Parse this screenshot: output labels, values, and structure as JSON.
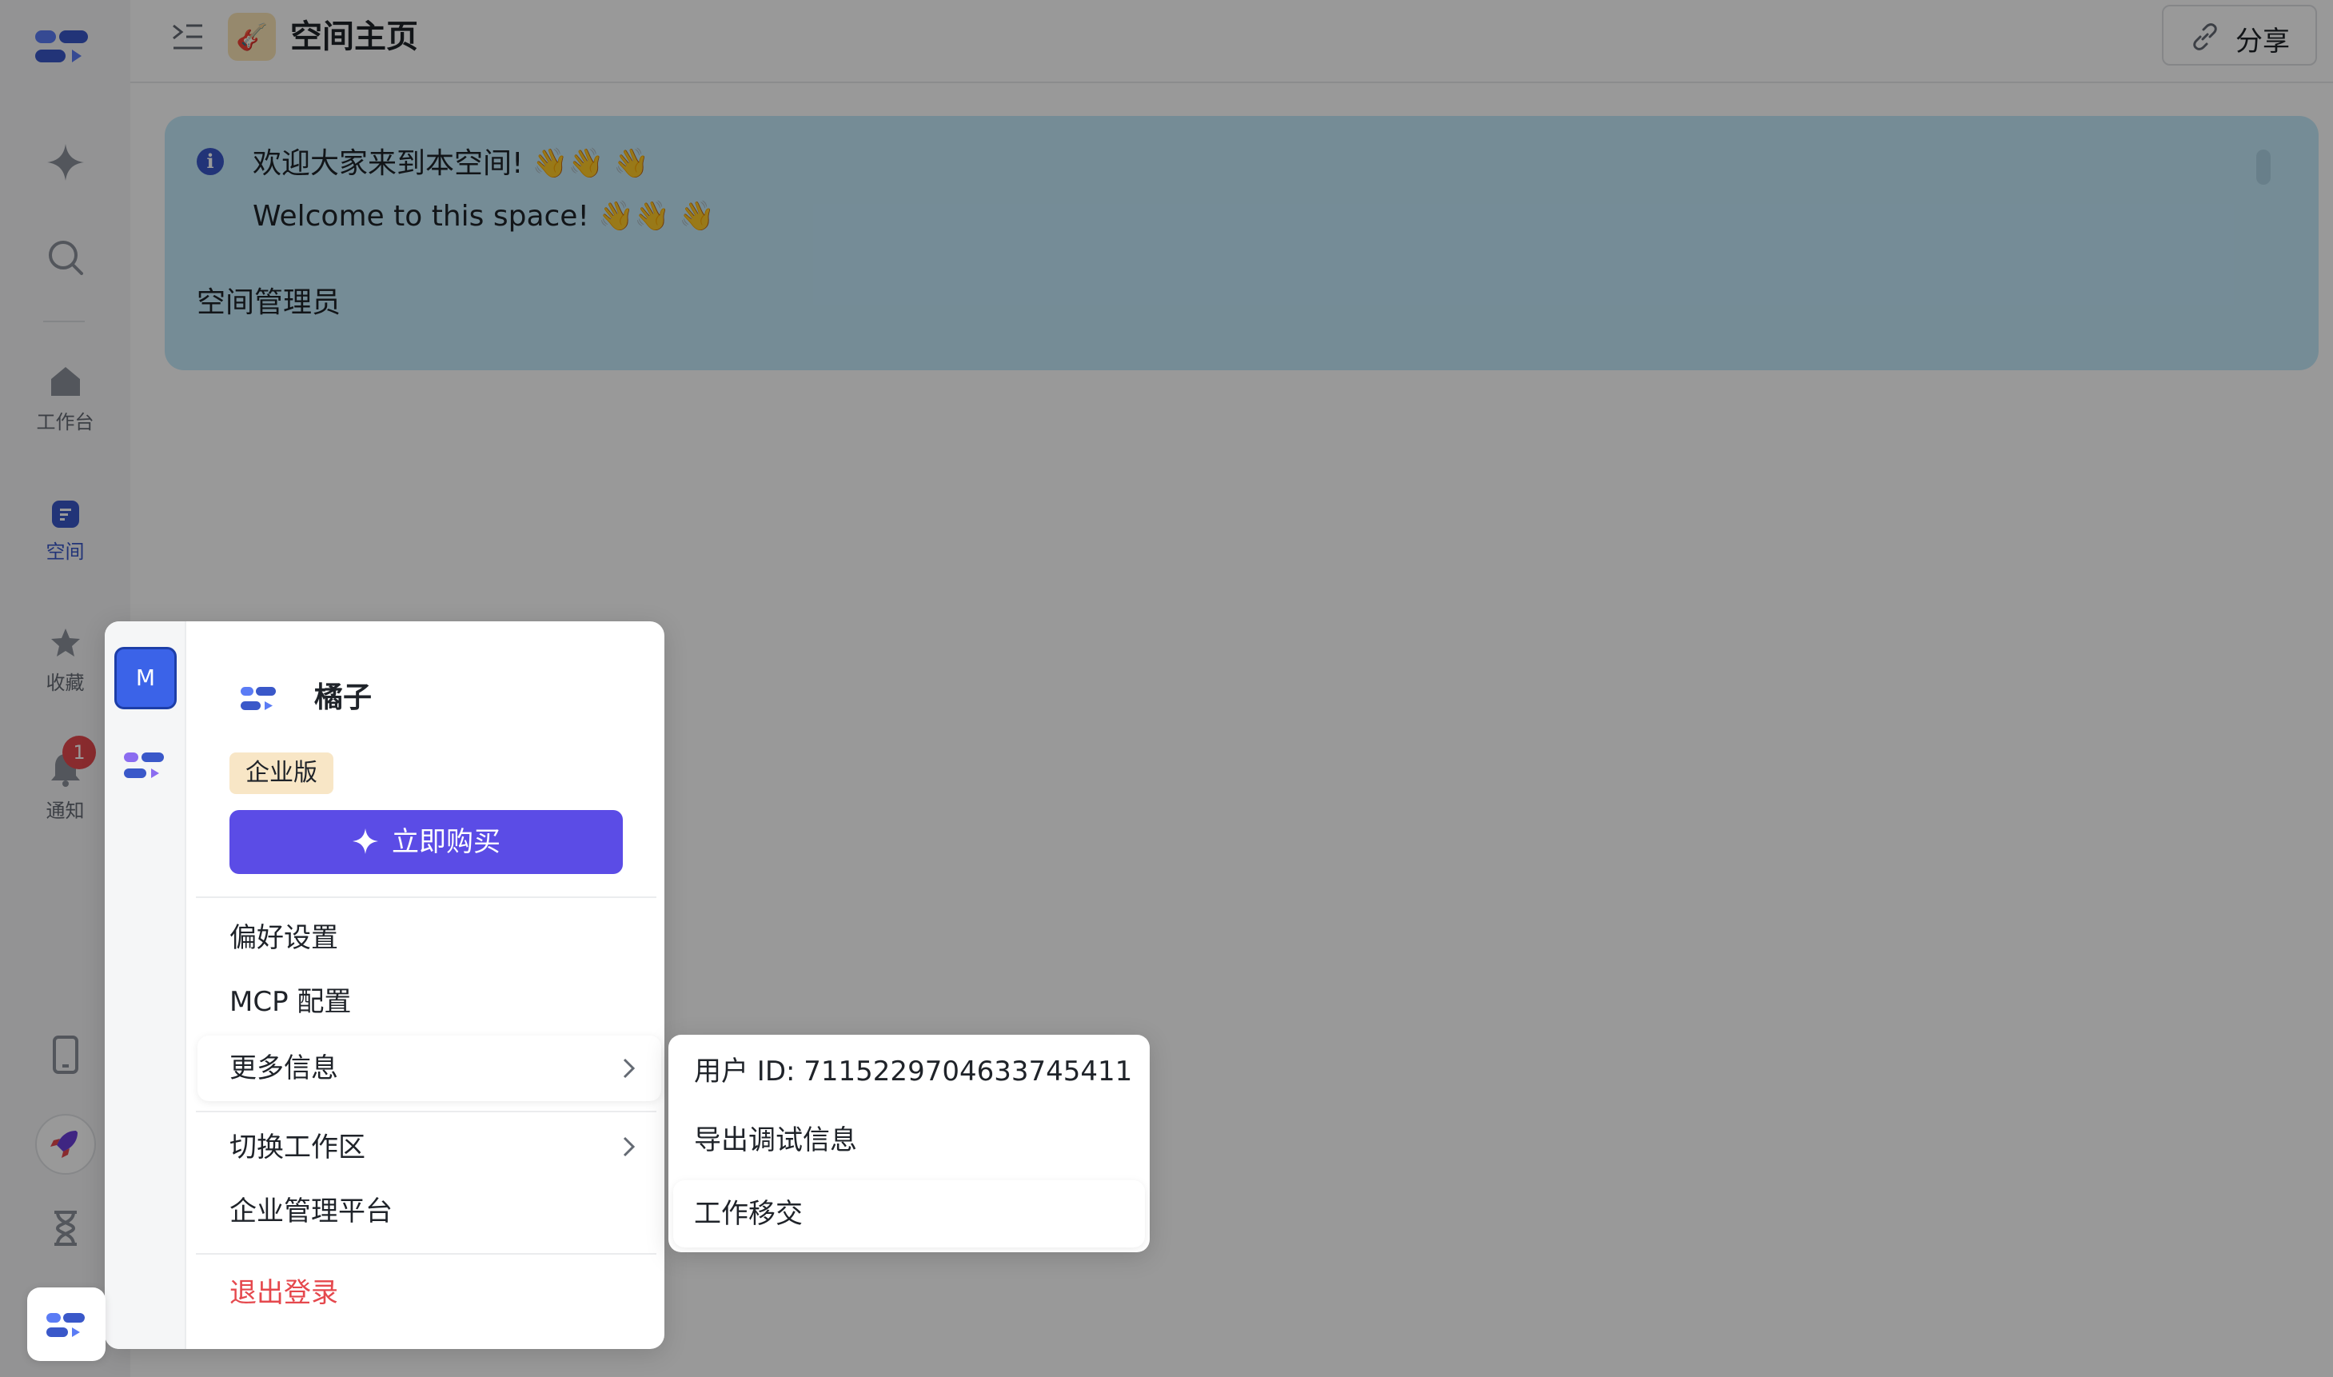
{
  "sidebar": {
    "items": [
      {
        "label": "工作台",
        "icon": "home-icon"
      },
      {
        "label": "空间",
        "icon": "space-icon"
      },
      {
        "label": "收藏",
        "icon": "star-icon"
      },
      {
        "label": "通知",
        "icon": "bell-icon"
      }
    ],
    "notification_count": "1"
  },
  "header": {
    "title": "空间主页",
    "share_label": "分享"
  },
  "callout": {
    "line1": "欢迎大家来到本空间! 👋👋 👋",
    "line2": "Welcome to this space! 👋👋 👋",
    "line3": "空间管理员"
  },
  "account_menu": {
    "workspace_avatar_letter": "M",
    "org_name": "橘子",
    "edition": "企业版",
    "buy_label": "立即购买",
    "items": {
      "preferences": "偏好设置",
      "mcp": "MCP 配置",
      "more_info": "更多信息",
      "switch_workspace": "切换工作区",
      "admin_platform": "企业管理平台",
      "logout": "退出登录"
    }
  },
  "more_info_submenu": {
    "user_id": "用户 ID: 7115229704633745411",
    "export_debug": "导出调试信息",
    "work_handover": "工作移交"
  },
  "colors": {
    "accent": "#5b4ce6",
    "callout_bg": "#c3eafb",
    "danger": "#e5484d",
    "active_blue": "#3a58c9"
  }
}
